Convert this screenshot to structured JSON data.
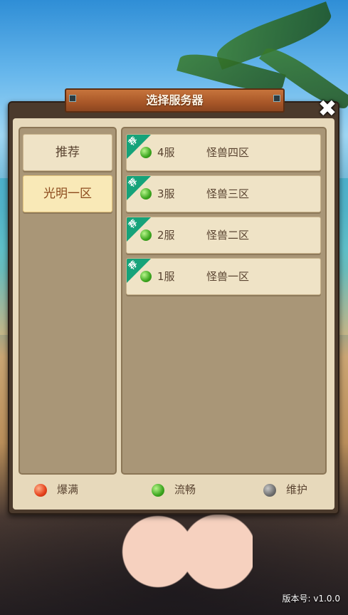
{
  "dialog": {
    "title": "选择服务器",
    "close_icon": "close-icon"
  },
  "categories": [
    {
      "label": "推荐",
      "active": false
    },
    {
      "label": "光明一区",
      "active": true
    }
  ],
  "servers": [
    {
      "tag": "荐",
      "status": "green",
      "number": "4服",
      "name": "怪兽四区"
    },
    {
      "tag": "荐",
      "status": "green",
      "number": "3服",
      "name": "怪兽三区"
    },
    {
      "tag": "荐",
      "status": "green",
      "number": "2服",
      "name": "怪兽二区"
    },
    {
      "tag": "荐",
      "status": "green",
      "number": "1服",
      "name": "怪兽一区"
    }
  ],
  "legend": {
    "full": {
      "label": "爆满",
      "color": "#e5401a"
    },
    "smooth": {
      "label": "流畅",
      "color": "#3ba51e"
    },
    "maintenance": {
      "label": "维护",
      "color": "#6e6e6e"
    }
  },
  "version": "版本号: v1.0.0",
  "colors": {
    "tag_green": "#16a37a",
    "panel_title": "#a85728",
    "panel_bg": "#e7d9bb"
  }
}
